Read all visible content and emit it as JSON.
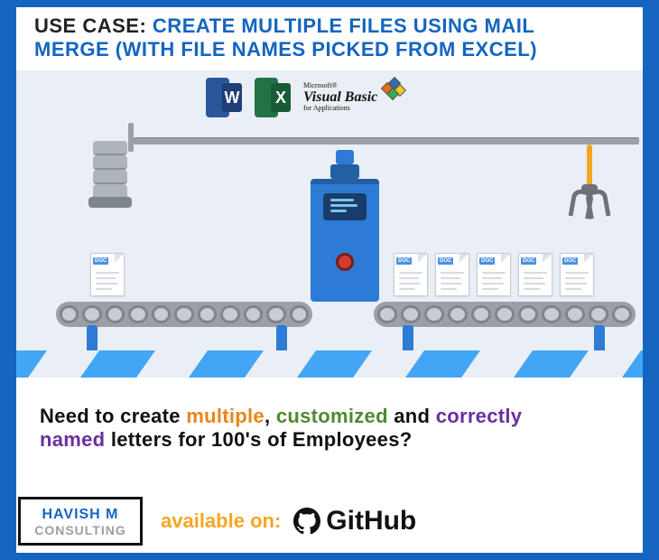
{
  "header": {
    "label": "USE CASE:",
    "title_line1": "CREATE MULTIPLE FILES USING MAIL",
    "title_line2": "MERGE (WITH FILE NAMES PICKED FROM EXCEL)"
  },
  "logos": {
    "word_letter": "W",
    "excel_letter": "X",
    "ms": "Microsoft®",
    "vb": "Visual Basic",
    "fa": "for Applications"
  },
  "doc_tag": "DOC",
  "blurb": {
    "p1": "Need to create ",
    "w_multiple": "multiple",
    "sep1": ", ",
    "w_customized": "customized",
    "sep2": " and ",
    "w_correctly": "correctly",
    "w_named": "named",
    "p2": " letters for 100's of Employees?"
  },
  "badge": {
    "name": "HAVISH M",
    "sub": "CONSULTING"
  },
  "available": {
    "label": "available on:",
    "platform": "GitHub"
  }
}
